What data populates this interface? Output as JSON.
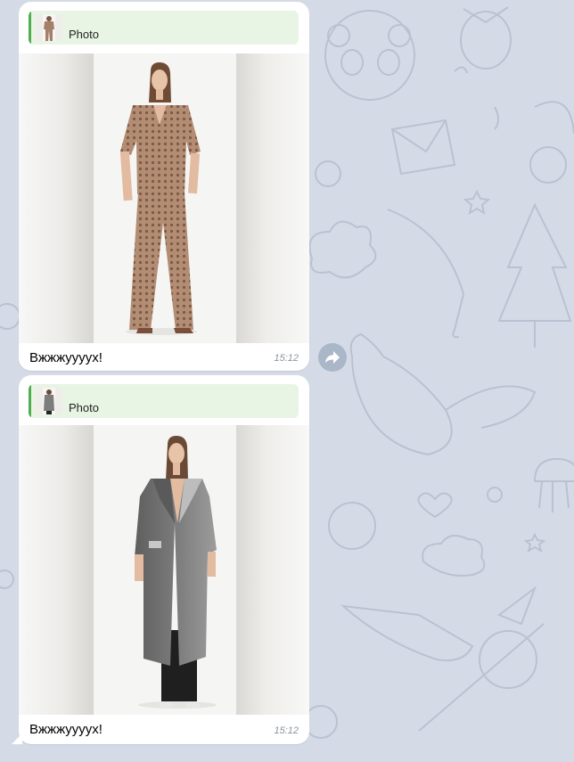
{
  "messages": [
    {
      "reply_label": "Photo",
      "caption": "Вжжжуууух!",
      "time": "15:12",
      "outfit_color": "#b08a70"
    },
    {
      "reply_label": "Photo",
      "caption": "Вжжжуууух!",
      "time": "15:12",
      "outfit_color": "#7e7e7e"
    }
  ],
  "colors": {
    "background": "#d5dbe6",
    "bubble": "#ffffff",
    "reply_bg": "#e8f4e4",
    "reply_accent": "#4fae4e",
    "time": "#8a949e",
    "forward_button": "#a9b7c8"
  },
  "icons": {
    "forward": "forward-arrow-icon"
  }
}
